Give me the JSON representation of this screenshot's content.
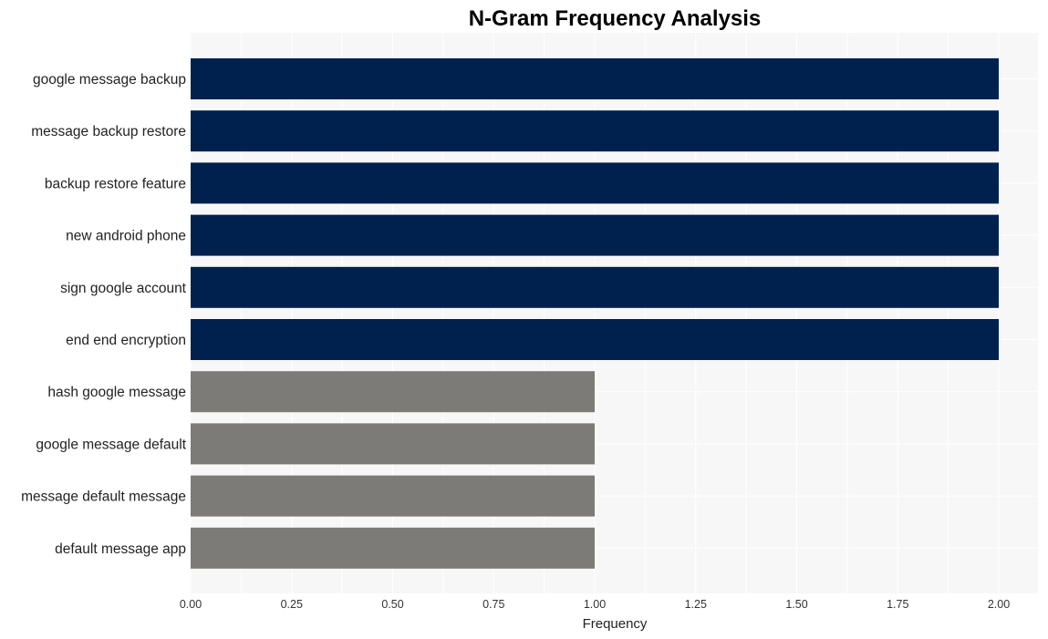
{
  "chart_data": {
    "type": "bar",
    "orientation": "horizontal",
    "title": "N-Gram Frequency Analysis",
    "xlabel": "Frequency",
    "ylabel": "",
    "xlim": [
      0,
      2.1
    ],
    "x_ticks": [
      "0.00",
      "0.25",
      "0.50",
      "0.75",
      "1.00",
      "1.25",
      "1.50",
      "1.75",
      "2.00"
    ],
    "grid": true,
    "categories": [
      "google message backup",
      "message backup restore",
      "backup restore feature",
      "new android phone",
      "sign google account",
      "end end encryption",
      "hash google message",
      "google message default",
      "message default message",
      "default message app"
    ],
    "values": [
      2,
      2,
      2,
      2,
      2,
      2,
      1,
      1,
      1,
      1
    ],
    "colors": {
      "high": "#00214e",
      "low": "#7d7b77",
      "plot_background": "#f7f7f7",
      "grid": "#ffffff"
    }
  }
}
